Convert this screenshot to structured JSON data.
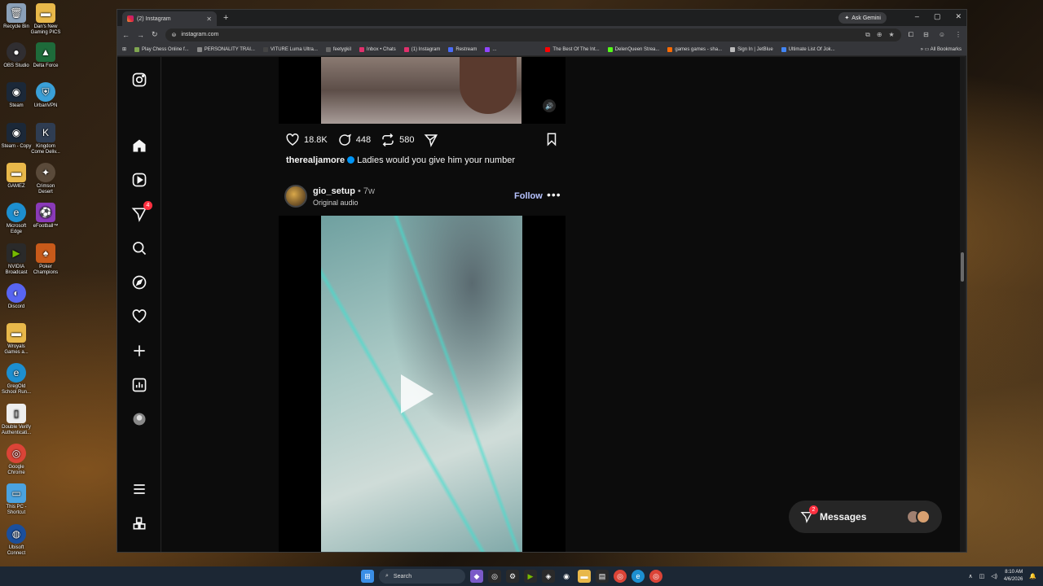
{
  "desktop": {
    "icons": [
      {
        "label": "Recycle Bin",
        "glyph": "🗑"
      },
      {
        "label": "OBS Studio",
        "glyph": "●"
      },
      {
        "label": "Steam",
        "glyph": "◉"
      },
      {
        "label": "Steam - Copy",
        "glyph": "◉"
      },
      {
        "label": "GAMEZ",
        "glyph": "▬"
      },
      {
        "label": "Microsoft Edge",
        "glyph": "e"
      },
      {
        "label": "NVIDIA Broadcast",
        "glyph": "▶"
      },
      {
        "label": "Discord",
        "glyph": "◐"
      },
      {
        "label": "Wroyals Games a...",
        "glyph": "▬"
      },
      {
        "label": "GregOld School Run...",
        "glyph": "e"
      },
      {
        "label": "Double Verify Authenticati...",
        "glyph": "▯"
      },
      {
        "label": "Google Chrome",
        "glyph": "◎"
      },
      {
        "label": "This PC - Shortcut",
        "glyph": "▭"
      },
      {
        "label": "Ubisoft Connect",
        "glyph": "◍"
      },
      {
        "label": "Dan's New Gaming PICS",
        "glyph": "▬"
      },
      {
        "label": "Delta Force",
        "glyph": "▲"
      },
      {
        "label": "UrbanVPN",
        "glyph": "⛨"
      },
      {
        "label": "Kingdom Come Deliv...",
        "glyph": "K"
      },
      {
        "label": "Crimson Desert",
        "glyph": "✦"
      },
      {
        "label": "eFootball™",
        "glyph": "⚽"
      },
      {
        "label": "Poker Champions",
        "glyph": "♠"
      }
    ]
  },
  "browser": {
    "tab_title": "(2) Instagram",
    "new_tab": "+",
    "ask_gemini": "Ask Gemini",
    "url": "instagram.com",
    "window_controls": {
      "minimize": "–",
      "maximize": "▢",
      "close": "✕"
    },
    "bookmarks": [
      {
        "label": "Play Chess Online f...",
        "color": "#7fa650"
      },
      {
        "label": "PERSONALITY TRAI...",
        "color": "#888888"
      },
      {
        "label": "VITURE Luma Ultra...",
        "color": "#444444"
      },
      {
        "label": "feetygkil",
        "color": "#666666"
      },
      {
        "label": "Inbox • Chats",
        "color": "#e1306c"
      },
      {
        "label": "(1) Instagram",
        "color": "#e1306c"
      },
      {
        "label": "Restream",
        "color": "#4a6cf7"
      },
      {
        "label": "...",
        "color": "#9146ff"
      },
      {
        "label": "The Best Of The Int...",
        "color": "#ff0000"
      },
      {
        "label": "DelenQueen Strea...",
        "color": "#53fc18"
      },
      {
        "label": "games games - sha...",
        "color": "#ff6a00"
      },
      {
        "label": "Sign In | JetBlue",
        "color": "#bbbbbb"
      },
      {
        "label": "Ultimate List Of Jok...",
        "color": "#4285f4"
      }
    ],
    "all_bookmarks": "All Bookmarks"
  },
  "instagram": {
    "sidebar_icons": [
      "instagram-logo-icon",
      "home-icon",
      "reels-icon",
      "messages-icon",
      "search-icon",
      "explore-icon",
      "notifications-icon",
      "create-icon",
      "dashboard-icon",
      "profile-avatar",
      "menu-icon",
      "more-apps-icon"
    ],
    "messages_badge": "4",
    "post1": {
      "likes": "18.8K",
      "comments": "448",
      "reposts": "580",
      "username": "therealjamore",
      "caption": "Ladies would you give him your number"
    },
    "post2": {
      "username": "gio_setup",
      "age": " • 7w",
      "audio": "Original audio",
      "follow": "Follow",
      "more": "•••"
    },
    "messages_pill": {
      "label": "Messages",
      "badge": "2"
    }
  },
  "taskbar": {
    "search_label": "Search",
    "time": "8:10 AM",
    "date": "4/6/2026"
  },
  "colors": {
    "accent": "#0095f6",
    "notification": "#ff3040",
    "follow": "#b7c3ff"
  }
}
